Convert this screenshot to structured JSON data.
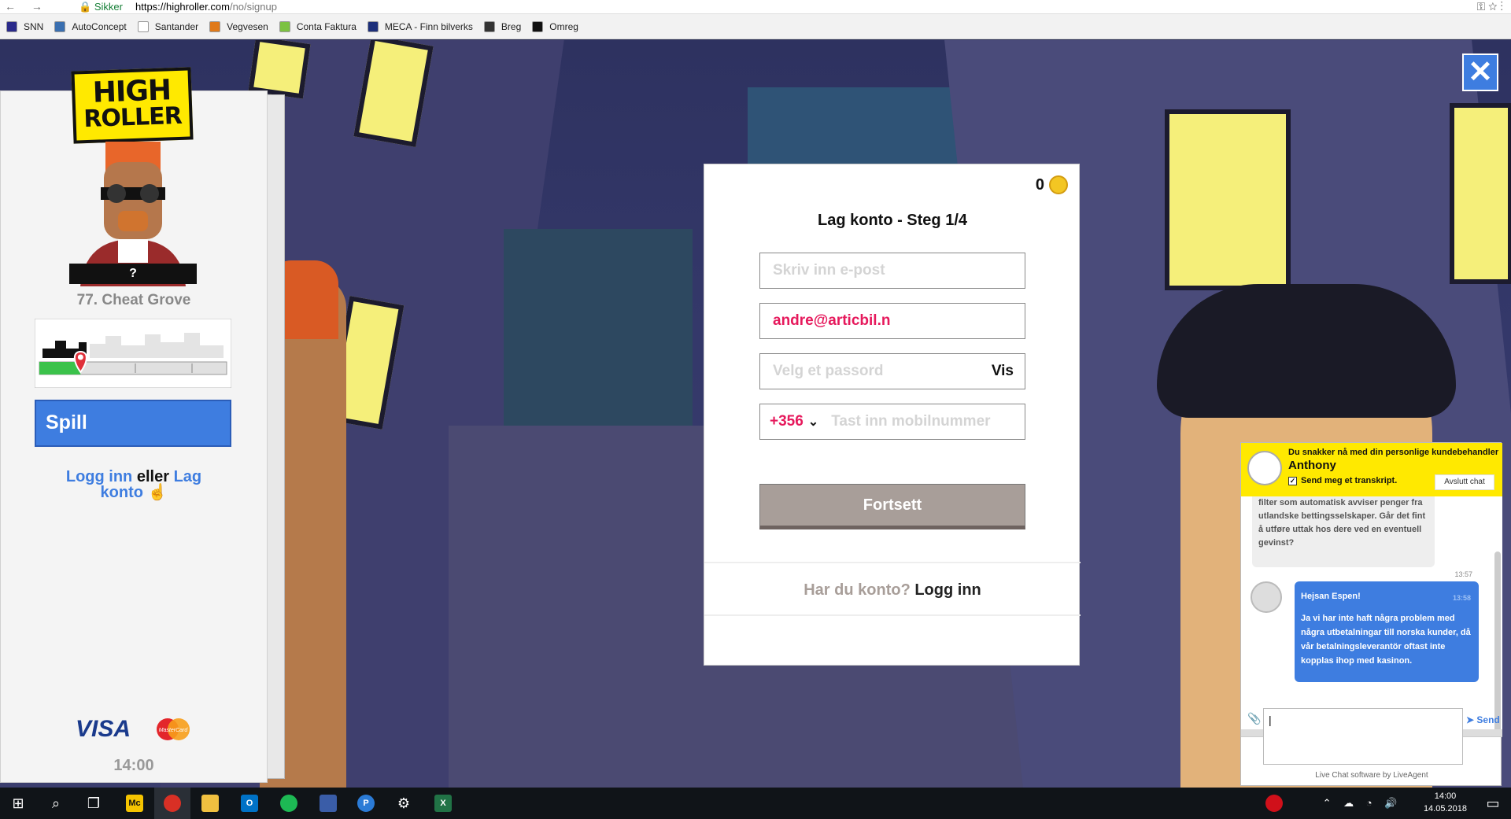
{
  "browser": {
    "secure_label": "Sikker",
    "url_host": "https://highroller.com",
    "url_path": "/no/signup"
  },
  "bookmarks": [
    {
      "label": "SNN",
      "icon": "snn-icon",
      "color": "#2a2a8a"
    },
    {
      "label": "AutoConcept",
      "icon": "autoconcept-icon",
      "color": "#3a6fb0"
    },
    {
      "label": "Santander",
      "icon": "page-icon",
      "color": "#ffffff"
    },
    {
      "label": "Vegvesen",
      "icon": "vegvesen-icon",
      "color": "#e07a1a"
    },
    {
      "label": "Conta Faktura",
      "icon": "conta-icon",
      "color": "#7cc242"
    },
    {
      "label": "MECA - Finn bilverks",
      "icon": "meca-icon",
      "color": "#1d2f7a"
    },
    {
      "label": "Breg",
      "icon": "breg-icon",
      "color": "#333333"
    },
    {
      "label": "Omreg",
      "icon": "omreg-icon",
      "color": "#111111"
    }
  ],
  "left_panel": {
    "logo_line1": "HIGH",
    "logo_line2": "ROLLER",
    "rank_badge": "?",
    "rank_name": "77. Cheat Grove",
    "spill_label": "Spill",
    "login_label": "Logg inn",
    "or_label": "eller",
    "create_label": "Lag konto",
    "visa_label": "VISA",
    "mastercard_label": "MasterCard",
    "time": "14:00",
    "progress_level": 0.22
  },
  "modal": {
    "coin_count": "0",
    "title": "Lag konto - Steg 1/4",
    "email_placeholder": "Skriv inn e-post",
    "email_confirm_value": "andre@articbil.n",
    "password_placeholder": "Velg et passord",
    "show_label": "Vis",
    "country_code": "+356",
    "phone_placeholder": "Tast inn mobilnummer",
    "continue_label": "Fortsett",
    "has_account": "Har du konto?",
    "login_link": "Logg inn"
  },
  "close_glyph": "✕",
  "chat": {
    "intro": "Du snakker nå med din personlige kundebehandler",
    "agent_name": "Anthony",
    "transcript_label": "Send meg et transkript.",
    "end_label": "Avslutt chat",
    "msg_in": "filter som automatisk avviser penger fra utlandske bettingsselskaper. Går det fint å utføre uttak hos dere ved en eventuell gevinst?",
    "msg_in_time": "13:57",
    "msg_out_greeting": "Hejsan Espen!",
    "msg_out_time": "13:58",
    "msg_out_body": "Ja vi har inte haft några problem med några utbetalningar till norska kunder, då vår betalningsleverantör oftast inte kopplas ihop med kasinon.",
    "send_label": "Send",
    "footer": "Live Chat software by LiveAgent"
  },
  "taskbar": {
    "time": "14:00",
    "date": "14.05.2018"
  }
}
